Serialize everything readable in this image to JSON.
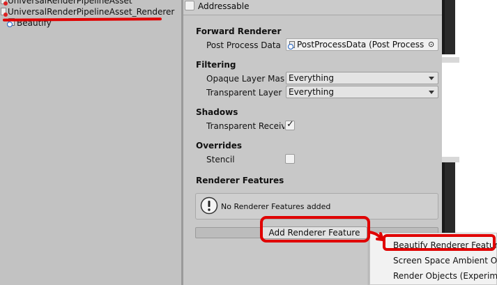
{
  "project_panel": {
    "items": [
      {
        "label": "UniversalRenderPipelineAsset",
        "icon": "render-pipeline-asset-icon"
      },
      {
        "label": "UniversalRenderPipelineAsset_Renderer",
        "icon": "render-pipeline-asset-icon"
      },
      {
        "label": "Beautify",
        "icon": "script-asset-icon"
      }
    ]
  },
  "inspector": {
    "addressable_label": "Addressable",
    "sections": {
      "forward_renderer": {
        "title": "Forward Renderer",
        "post_process_label": "Post Process Data",
        "post_process_value": "PostProcessData (Post Process D"
      },
      "filtering": {
        "title": "Filtering",
        "opaque_label": "Opaque Layer Mask",
        "opaque_value": "Everything",
        "transparent_label": "Transparent Layer Mask",
        "transparent_value": "Everything"
      },
      "shadows": {
        "title": "Shadows",
        "transparent_receive_label": "Transparent Receive Shadows",
        "transparent_receive_checked": true
      },
      "overrides": {
        "title": "Overrides",
        "stencil_label": "Stencil",
        "stencil_checked": false
      },
      "renderer_features": {
        "title": "Renderer Features",
        "empty_message": "No Renderer Features added",
        "add_button": "Add Renderer Feature"
      }
    }
  },
  "add_feature_menu": {
    "items": [
      {
        "label": "Beautify Renderer Feature"
      },
      {
        "label": "Screen Space Ambient Occlusion"
      },
      {
        "label": "Render Objects (Experimental)"
      }
    ]
  },
  "colors": {
    "annotation_red": "#e00000",
    "panel_gray": "#c2c2c2",
    "inspector_gray": "#c8c8c8"
  }
}
